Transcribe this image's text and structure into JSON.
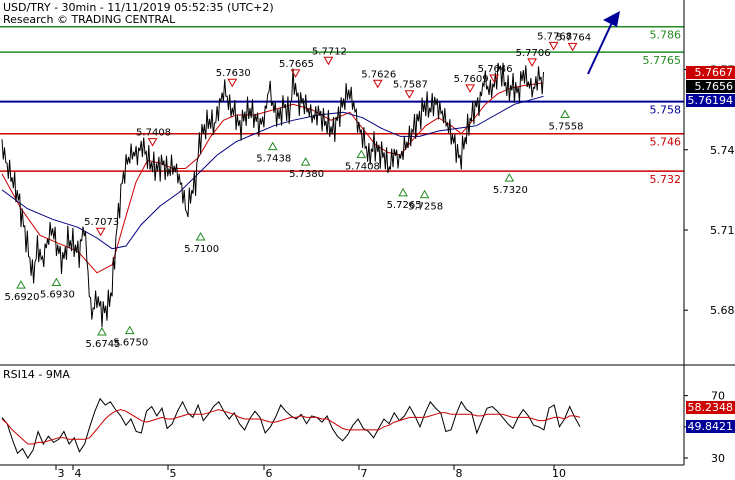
{
  "header": {
    "title": "USD/TRY - 30min - 11/11/2019 05:52:35 (UTC+2)",
    "subtitle": "Research © TRADING CENTRAL"
  },
  "rsi_panel": {
    "label": "RSI14 - 9MA",
    "axis_ticks": [
      "70",
      "50",
      "30"
    ],
    "rsi_value": "49.8421",
    "ma_value": "58.2348"
  },
  "colors": {
    "price": "#000000",
    "fast_ma": "#cc0000",
    "slow_ma": "#000080",
    "resistance": "#228b22",
    "support": "#cc0000",
    "pivot": "#000099",
    "rsi": "#000000",
    "rsi_ma": "#cc0000",
    "arrow": "#000099"
  },
  "chart_data": [
    {
      "type": "line",
      "title": "USD/TRY - 30min - 11/11/2019 05:52:35 (UTC+2)",
      "x_tick_labels": [
        "3",
        "4",
        "5",
        "6",
        "7",
        "8",
        "10"
      ],
      "y_tick_labels": [
        "5.77",
        "5.74",
        "5.71",
        "5.68"
      ],
      "ylim": [
        5.667,
        5.793
      ],
      "grid": false,
      "price_path": [
        [
          0,
          5.742
        ],
        [
          0.4,
          5.734
        ],
        [
          0.9,
          5.728
        ],
        [
          1.3,
          5.722
        ],
        [
          1.7,
          5.712
        ],
        [
          2.1,
          5.702
        ],
        [
          2.45,
          5.692
        ],
        [
          2.8,
          5.704
        ],
        [
          3.2,
          5.698
        ],
        [
          3.6,
          5.706
        ],
        [
          3.95,
          5.711
        ],
        [
          4.4,
          5.703
        ],
        [
          4.8,
          5.698
        ],
        [
          5.2,
          5.706
        ],
        [
          5.6,
          5.705
        ],
        [
          6.1,
          5.701
        ],
        [
          6.5,
          5.712
        ],
        [
          6.8,
          5.694
        ],
        [
          7.05,
          5.678
        ],
        [
          7.5,
          5.685
        ],
        [
          7.9,
          5.679
        ],
        [
          8.35,
          5.681
        ],
        [
          8.7,
          5.688
        ],
        [
          9.1,
          5.712
        ],
        [
          9.5,
          5.728
        ],
        [
          9.9,
          5.736
        ],
        [
          10.3,
          5.739
        ],
        [
          10.7,
          5.738
        ],
        [
          11.1,
          5.742
        ],
        [
          11.5,
          5.737
        ],
        [
          11.9,
          5.734
        ],
        [
          12.3,
          5.733
        ],
        [
          12.7,
          5.735
        ],
        [
          13.1,
          5.732
        ],
        [
          13.5,
          5.734
        ],
        [
          13.9,
          5.731
        ],
        [
          14.3,
          5.724
        ],
        [
          14.6,
          5.716
        ],
        [
          14.9,
          5.723
        ],
        [
          15.3,
          5.728
        ],
        [
          15.6,
          5.743
        ],
        [
          16,
          5.748
        ],
        [
          16.4,
          5.751
        ],
        [
          16.8,
          5.749
        ],
        [
          17.2,
          5.757
        ],
        [
          17.6,
          5.763
        ],
        [
          18,
          5.756
        ],
        [
          18.4,
          5.754
        ],
        [
          18.8,
          5.748
        ],
        [
          19.2,
          5.753
        ],
        [
          19.6,
          5.755
        ],
        [
          20,
          5.752
        ],
        [
          20.4,
          5.749
        ],
        [
          20.8,
          5.753
        ],
        [
          21.1,
          5.764
        ],
        [
          21.5,
          5.755
        ],
        [
          21.9,
          5.752
        ],
        [
          22.3,
          5.757
        ],
        [
          22.7,
          5.753
        ],
        [
          23.05,
          5.767
        ],
        [
          23.4,
          5.758
        ],
        [
          23.8,
          5.758
        ],
        [
          24.2,
          5.755
        ],
        [
          24.6,
          5.752
        ],
        [
          25,
          5.754
        ],
        [
          25.4,
          5.751
        ],
        [
          25.8,
          5.749
        ],
        [
          26.2,
          5.747
        ],
        [
          26.6,
          5.753
        ],
        [
          27,
          5.758
        ],
        [
          27.4,
          5.762
        ],
        [
          27.8,
          5.757
        ],
        [
          28.2,
          5.748
        ],
        [
          28.6,
          5.744
        ],
        [
          29,
          5.737
        ],
        [
          29.4,
          5.742
        ],
        [
          29.8,
          5.739
        ],
        [
          30.2,
          5.738
        ],
        [
          30.6,
          5.733
        ],
        [
          31,
          5.739
        ],
        [
          31.4,
          5.736
        ],
        [
          31.8,
          5.741
        ],
        [
          32.2,
          5.744
        ],
        [
          32.6,
          5.749
        ],
        [
          33,
          5.752
        ],
        [
          33.4,
          5.757
        ],
        [
          33.8,
          5.755
        ],
        [
          34.2,
          5.758
        ],
        [
          34.6,
          5.755
        ],
        [
          35,
          5.752
        ],
        [
          35.4,
          5.747
        ],
        [
          35.8,
          5.742
        ],
        [
          36.2,
          5.736
        ],
        [
          36.6,
          5.744
        ],
        [
          37,
          5.751
        ],
        [
          37.4,
          5.756
        ],
        [
          37.8,
          5.758
        ],
        [
          38.1,
          5.767
        ],
        [
          38.5,
          5.762
        ],
        [
          38.9,
          5.764
        ],
        [
          39.3,
          5.771
        ],
        [
          39.7,
          5.766
        ],
        [
          40,
          5.762
        ],
        [
          40.4,
          5.764
        ],
        [
          40.8,
          5.761
        ],
        [
          41.2,
          5.769
        ],
        [
          41.6,
          5.765
        ],
        [
          42,
          5.762
        ],
        [
          42.4,
          5.768
        ],
        [
          42.8,
          5.764
        ]
      ],
      "series": [
        {
          "name": "",
          "color": "#cc0000",
          "points": [
            [
              0,
              5.731
            ],
            [
              1.5,
              5.718
            ],
            [
              3,
              5.708
            ],
            [
              4.5,
              5.705
            ],
            [
              6,
              5.702
            ],
            [
              7.5,
              5.694
            ],
            [
              8.7,
              5.697
            ],
            [
              9.6,
              5.712
            ],
            [
              10.6,
              5.728
            ],
            [
              11.5,
              5.736
            ],
            [
              12.5,
              5.735
            ],
            [
              13.5,
              5.733
            ],
            [
              14.5,
              5.733
            ],
            [
              15.5,
              5.737
            ],
            [
              16.5,
              5.745
            ],
            [
              17.5,
              5.751
            ],
            [
              18.5,
              5.753
            ],
            [
              20,
              5.753
            ],
            [
              21.5,
              5.755
            ],
            [
              23,
              5.757
            ],
            [
              24.5,
              5.755
            ],
            [
              26,
              5.751
            ],
            [
              27.5,
              5.754
            ],
            [
              28.5,
              5.748
            ],
            [
              29.5,
              5.742
            ],
            [
              30.5,
              5.739
            ],
            [
              31.5,
              5.738
            ],
            [
              32.5,
              5.744
            ],
            [
              33.5,
              5.749
            ],
            [
              34.5,
              5.752
            ],
            [
              35.5,
              5.749
            ],
            [
              36.3,
              5.746
            ],
            [
              37.2,
              5.751
            ],
            [
              38.2,
              5.757
            ],
            [
              39.2,
              5.761
            ],
            [
              40.2,
              5.763
            ],
            [
              41.2,
              5.764
            ],
            [
              42.8,
              5.765
            ]
          ]
        },
        {
          "name": "",
          "color": "#000080",
          "points": [
            [
              0,
              5.725
            ],
            [
              2,
              5.718
            ],
            [
              4,
              5.714
            ],
            [
              6,
              5.711
            ],
            [
              7.5,
              5.707
            ],
            [
              8.7,
              5.703
            ],
            [
              9.8,
              5.704
            ],
            [
              11,
              5.712
            ],
            [
              12.5,
              5.719
            ],
            [
              14,
              5.724
            ],
            [
              15.5,
              5.731
            ],
            [
              17,
              5.738
            ],
            [
              18.5,
              5.743
            ],
            [
              20,
              5.746
            ],
            [
              21.5,
              5.749
            ],
            [
              23,
              5.751
            ],
            [
              25,
              5.753
            ],
            [
              27,
              5.754
            ],
            [
              28.5,
              5.752
            ],
            [
              30,
              5.748
            ],
            [
              31.5,
              5.745
            ],
            [
              33,
              5.745
            ],
            [
              34.5,
              5.747
            ],
            [
              36,
              5.748
            ],
            [
              37.5,
              5.749
            ],
            [
              39,
              5.753
            ],
            [
              40.5,
              5.757
            ],
            [
              42.8,
              5.76
            ]
          ]
        }
      ],
      "horizontal_levels": [
        {
          "value": 5.786,
          "label": "5.786",
          "role": "resistance"
        },
        {
          "value": 5.7765,
          "label": "5.7765",
          "role": "resistance"
        },
        {
          "value": 5.758,
          "label": "5.758",
          "role": "pivot"
        },
        {
          "value": 5.746,
          "label": "5.746",
          "role": "support"
        },
        {
          "value": 5.732,
          "label": "5.732",
          "role": "support"
        }
      ],
      "right_axis_badges": [
        {
          "value": 5.7667,
          "label": "5.7667"
        },
        {
          "value": 5.7656,
          "label": "5.7656"
        },
        {
          "value": 5.76194,
          "label": "5.76194"
        }
      ],
      "highs": [
        {
          "x": 7.8,
          "value": 5.7073,
          "label": "5.7073"
        },
        {
          "x": 11.9,
          "value": 5.7408,
          "label": "5.7408"
        },
        {
          "x": 18.2,
          "value": 5.763,
          "label": "5.7630"
        },
        {
          "x": 23.2,
          "value": 5.7665,
          "label": "5.7665"
        },
        {
          "x": 25.8,
          "value": 5.7712,
          "label": "5.7712"
        },
        {
          "x": 29.7,
          "value": 5.7626,
          "label": "5.7626"
        },
        {
          "x": 32.2,
          "value": 5.7587,
          "label": "5.7587"
        },
        {
          "x": 37,
          "value": 5.7609,
          "label": "5.7609"
        },
        {
          "x": 38.9,
          "value": 5.7646,
          "label": "5.7646"
        },
        {
          "x": 41.9,
          "value": 5.7706,
          "label": "5.7706"
        },
        {
          "x": 43.6,
          "value": 5.7768,
          "label": "5.7768"
        },
        {
          "x": 45.1,
          "value": 5.7764,
          "label": "5.7764"
        }
      ],
      "lows": [
        {
          "x": 1.5,
          "value": 5.692,
          "label": "5.6920"
        },
        {
          "x": 4.3,
          "value": 5.693,
          "label": "5.6930"
        },
        {
          "x": 7.9,
          "value": 5.6745,
          "label": "5.6745"
        },
        {
          "x": 10.1,
          "value": 5.675,
          "label": "5.6750"
        },
        {
          "x": 15.7,
          "value": 5.71,
          "label": "5.7100"
        },
        {
          "x": 21.4,
          "value": 5.7438,
          "label": "5.7438"
        },
        {
          "x": 24,
          "value": 5.738,
          "label": "5.7380"
        },
        {
          "x": 28.4,
          "value": 5.7408,
          "label": "5.7408"
        },
        {
          "x": 31.7,
          "value": 5.7265,
          "label": "5.7265"
        },
        {
          "x": 33.4,
          "value": 5.7258,
          "label": "5.7258"
        },
        {
          "x": 40.1,
          "value": 5.732,
          "label": "5.7320"
        },
        {
          "x": 44.5,
          "value": 5.7558,
          "label": "5.7558"
        }
      ]
    },
    {
      "type": "line",
      "title": "RSI14 - 9MA",
      "ylim": [
        30,
        80
      ],
      "y_tick_labels": [
        "70",
        "50",
        "30"
      ],
      "x_tick_labels": [
        "3",
        "4",
        "5",
        "6",
        "7",
        "8",
        "10"
      ],
      "series": [
        {
          "name": "RSI14",
          "color": "#000000",
          "values": [
            56,
            52,
            42,
            33,
            36,
            30,
            35,
            47,
            39,
            44,
            40,
            42,
            47,
            39,
            43,
            34,
            39,
            50,
            60,
            68,
            64,
            66,
            61,
            57,
            51,
            55,
            47,
            46,
            60,
            63,
            57,
            62,
            49,
            52,
            60,
            66,
            59,
            56,
            64,
            54,
            58,
            63,
            66,
            60,
            55,
            59,
            52,
            48,
            55,
            60,
            56,
            46,
            50,
            56,
            64,
            60,
            57,
            55,
            58,
            52,
            57,
            56,
            53,
            57,
            49,
            44,
            41,
            45,
            51,
            55,
            49,
            47,
            43,
            49,
            55,
            52,
            59,
            54,
            57,
            63,
            57,
            50,
            59,
            66,
            62,
            59,
            47,
            48,
            58,
            66,
            61,
            59,
            46,
            54,
            62,
            63,
            60,
            56,
            52,
            49,
            56,
            61,
            57,
            51,
            50,
            48,
            62,
            64,
            50,
            55,
            63,
            56,
            50
          ]
        },
        {
          "name": "9MA",
          "color": "#cc0000",
          "values": [
            55,
            52,
            48,
            45,
            42,
            39,
            39,
            40,
            40,
            41,
            42,
            43,
            43,
            42,
            42,
            42,
            42,
            43,
            47,
            51,
            55,
            58,
            60,
            61,
            60,
            58,
            56,
            54,
            53,
            54,
            55,
            56,
            55,
            55,
            56,
            57,
            58,
            58,
            58,
            58,
            59,
            60,
            61,
            60,
            59,
            58,
            56,
            55,
            55,
            55,
            55,
            54,
            53,
            53,
            54,
            55,
            56,
            56,
            57,
            56,
            56,
            56,
            55,
            55,
            53,
            51,
            49,
            48,
            48,
            48,
            48,
            48,
            48,
            48,
            50,
            51,
            53,
            54,
            55,
            56,
            56,
            56,
            56,
            57,
            58,
            59,
            59,
            58,
            58,
            58,
            58,
            58,
            57,
            57,
            58,
            58,
            58,
            58,
            57,
            56,
            56,
            56,
            56,
            55,
            54,
            54,
            55,
            56,
            56,
            55,
            57,
            57,
            56
          ]
        }
      ],
      "latest_values": {
        "RSI14": 49.8421,
        "9MA": 58.2348
      }
    }
  ]
}
